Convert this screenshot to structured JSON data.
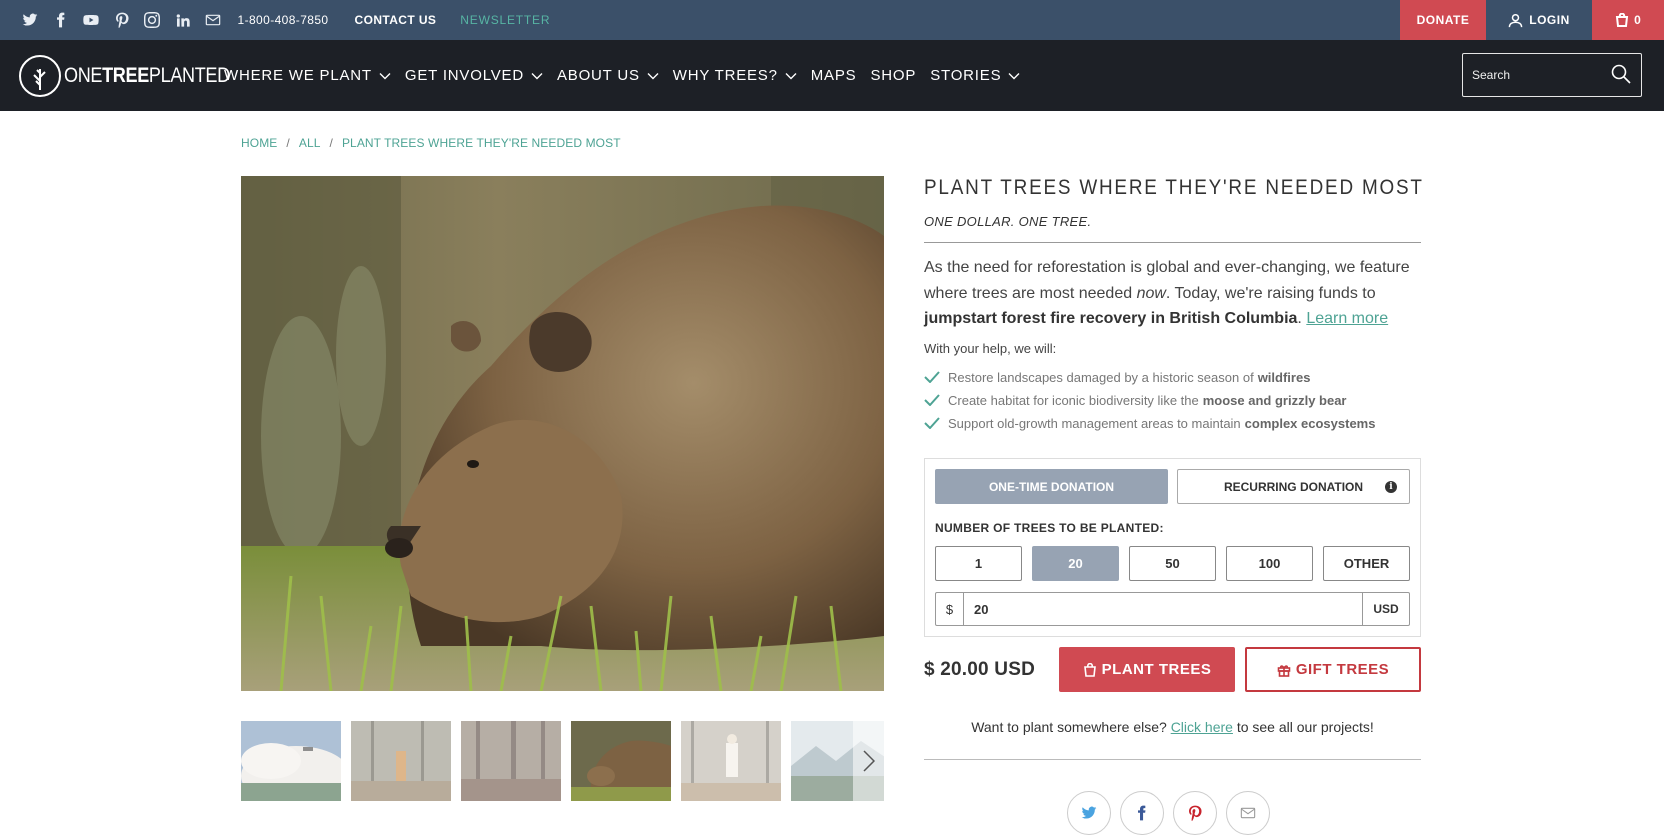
{
  "topbar": {
    "phone": "1-800-408-7850",
    "contact": "CONTACT US",
    "newsletter": "NEWSLETTER",
    "donate": "DONATE",
    "login": "LOGIN",
    "cart_count": "0",
    "social_icons": [
      "twitter-icon",
      "facebook-icon",
      "youtube-icon",
      "pinterest-icon",
      "instagram-icon",
      "linkedin-icon",
      "email-icon"
    ]
  },
  "logo": {
    "part1": "ONE",
    "part2": "TREE",
    "part3": "PLANTED"
  },
  "nav": {
    "items": [
      {
        "label": "WHERE WE PLANT",
        "dropdown": true
      },
      {
        "label": "GET INVOLVED",
        "dropdown": true
      },
      {
        "label": "ABOUT US",
        "dropdown": true
      },
      {
        "label": "WHY TREES?",
        "dropdown": true
      },
      {
        "label": "MAPS",
        "dropdown": false
      },
      {
        "label": "SHOP",
        "dropdown": false
      },
      {
        "label": "STORIES",
        "dropdown": true
      }
    ],
    "search_placeholder": "Search"
  },
  "breadcrumb": [
    "HOME",
    "ALL",
    "PLANT TREES WHERE THEY'RE NEEDED MOST"
  ],
  "product": {
    "title": "PLANT TREES WHERE THEY'RE NEEDED MOST",
    "subtitle": "ONE DOLLAR. ONE TREE.",
    "desc_1": "As the need for reforestation is global and ever-changing, we feature where trees are most needed ",
    "desc_2": "now",
    "desc_3": ". Today, we're raising funds to ",
    "desc_bold": "jumpstart forest fire recovery in British Columbia",
    "desc_4": ". ",
    "desc_link": "Learn more",
    "help_intro": "With your help, we will:",
    "goals": [
      {
        "text": "Restore landscapes damaged by a historic season of",
        "bold": "wildfires"
      },
      {
        "text": "Create habitat for iconic biodiversity like the",
        "bold": "moose and grizzly bear"
      },
      {
        "text": "Support old-growth management areas to maintain",
        "bold": "complex ecosystems"
      }
    ]
  },
  "donation": {
    "one_time": "ONE-TIME DONATION",
    "recurring": "RECURRING DONATION",
    "info": "i",
    "trees_label": "NUMBER OF TREES TO BE PLANTED:",
    "quantities": [
      "1",
      "20",
      "50",
      "100",
      "OTHER"
    ],
    "selected_quantity": "20",
    "currency_symbol": "$",
    "amount": "20",
    "currency": "USD"
  },
  "checkout": {
    "price": "$ 20.00 USD",
    "plant_button": "PLANT TREES",
    "gift_button": "GIFT TREES",
    "elsewhere_1": "Want to plant somewhere else?",
    "elsewhere_link": "Click here",
    "elsewhere_2": "to see all our projects!"
  },
  "share": [
    "twitter-icon",
    "facebook-icon",
    "pinterest-icon",
    "email-icon"
  ],
  "colors": {
    "topbar": "#3b5069",
    "nav": "#1d2026",
    "accent_red": "#d04a52",
    "accent_teal": "#4ea394",
    "selected_gray": "#97a3b3"
  }
}
